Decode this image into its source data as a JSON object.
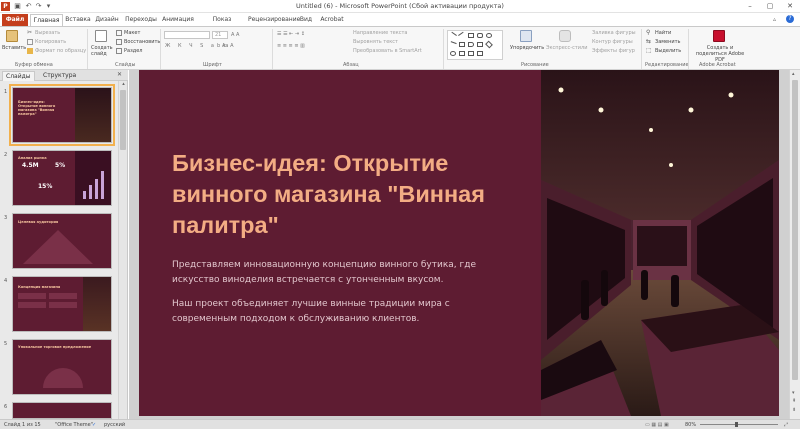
{
  "window": {
    "title": "Untitled (6)  -  Microsoft PowerPoint (Сбой активации продукта)"
  },
  "tabs": [
    {
      "label": "Файл"
    },
    {
      "label": "Главная"
    },
    {
      "label": "Вставка"
    },
    {
      "label": "Дизайн"
    },
    {
      "label": "Переходы"
    },
    {
      "label": "Анимация"
    },
    {
      "label": "Показ слайдов"
    },
    {
      "label": "Рецензирование"
    },
    {
      "label": "Вид"
    },
    {
      "label": "Acrobat"
    }
  ],
  "ribbon": {
    "clipboard": {
      "paste": "Вставить",
      "cut": "Вырезать",
      "copy": "Копировать",
      "format_painter": "Формат по образцу",
      "group": "Буфер обмена"
    },
    "slides": {
      "new_slide": "Создать слайд",
      "layout": "Макет",
      "reset": "Восстановить",
      "section": "Раздел",
      "group": "Слайды"
    },
    "font": {
      "size": "21",
      "group": "Шрифт"
    },
    "paragraph": {
      "text_direction": "Направление текста",
      "align_text": "Выровнять текст",
      "smartart": "Преобразовать в SmartArt",
      "group": "Абзац"
    },
    "drawing": {
      "arrange": "Упорядочить",
      "quick_styles": "Экспресс-стили",
      "fill": "Заливка фигуры",
      "outline": "Контур фигуры",
      "effects": "Эффекты фигур",
      "group": "Рисование"
    },
    "editing": {
      "find": "Найти",
      "replace": "Заменить",
      "select": "Выделить",
      "group": "Редактирование"
    },
    "acrobat": {
      "create_pdf": "Создать и поделиться Adobe PDF",
      "group": "Adobe Acrobat"
    }
  },
  "panel": {
    "tabs": [
      {
        "label": "Слайды"
      },
      {
        "label": "Структура"
      }
    ],
    "thumbs": [
      {
        "num": "1",
        "title": "Бизнес-идея: Открытие винного магазина \"Винная палитра\""
      },
      {
        "num": "2",
        "title": "Анализ рынка",
        "stat1": "4.5M",
        "stat2": "5%",
        "stat3": "15%"
      },
      {
        "num": "3",
        "title": "Целевая аудитория"
      },
      {
        "num": "4",
        "title": "Концепция магазина"
      },
      {
        "num": "5",
        "title": "Уникальное торговое предложение"
      },
      {
        "num": "6"
      }
    ]
  },
  "slide": {
    "title": "Бизнес-идея: Открытие винного магазина \"Винная палитра\"",
    "para1": "Представляем инновационную концепцию винного бутика, где искусство виноделия встречается с утонченным вкусом.",
    "para2": "Наш проект объединяет лучшие винные традиции мира с современным подходом к обслуживанию клиентов."
  },
  "status": {
    "slide_counter": "Слайд 1 из 15",
    "theme": "\"Office Theme\"",
    "language": "русский",
    "zoom": "80%"
  },
  "colors": {
    "slide_bg": "#5e1c32",
    "title": "#f3ad84",
    "body": "#e2c6cd",
    "file_tab": "#c43e1c"
  }
}
